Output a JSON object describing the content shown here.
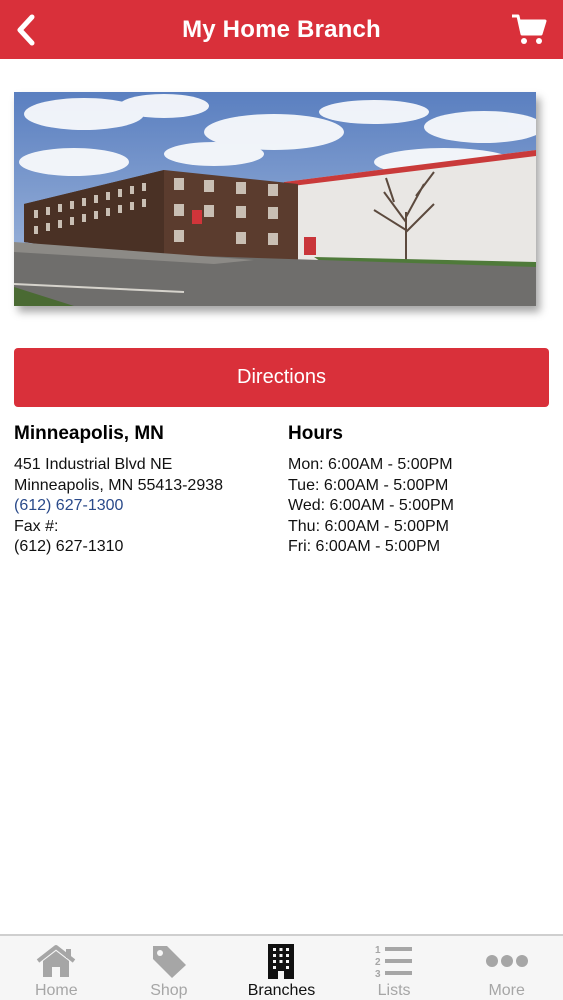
{
  "header": {
    "title": "My Home Branch",
    "back_icon": "chevron-left-icon",
    "cart_icon": "shopping-cart-icon"
  },
  "branch_photo": "warehouse-building-photo",
  "directions_label": "Directions",
  "branch": {
    "city": "Minneapolis, MN",
    "address_line1": "451 Industrial Blvd NE",
    "address_line2": "Minneapolis, MN 55413-2938",
    "phone": "(612) 627-1300",
    "fax_label": "Fax #:",
    "fax": "(612) 627-1310"
  },
  "hours": {
    "title": "Hours",
    "days": [
      "Mon: 6:00AM - 5:00PM",
      "Tue: 6:00AM - 5:00PM",
      "Wed: 6:00AM - 5:00PM",
      "Thu: 6:00AM - 5:00PM",
      "Fri: 6:00AM - 5:00PM"
    ]
  },
  "tabbar": {
    "items": [
      {
        "label": "Home",
        "icon": "home-icon",
        "active": false
      },
      {
        "label": "Shop",
        "icon": "tag-icon",
        "active": false
      },
      {
        "label": "Branches",
        "icon": "building-icon",
        "active": true
      },
      {
        "label": "Lists",
        "icon": "numbered-list-icon",
        "active": false
      },
      {
        "label": "More",
        "icon": "more-dots-icon",
        "active": false
      }
    ]
  },
  "colors": {
    "brand_red": "#d9303a",
    "link_blue": "#2a4a8a",
    "tab_inactive": "#a6a6a6"
  }
}
